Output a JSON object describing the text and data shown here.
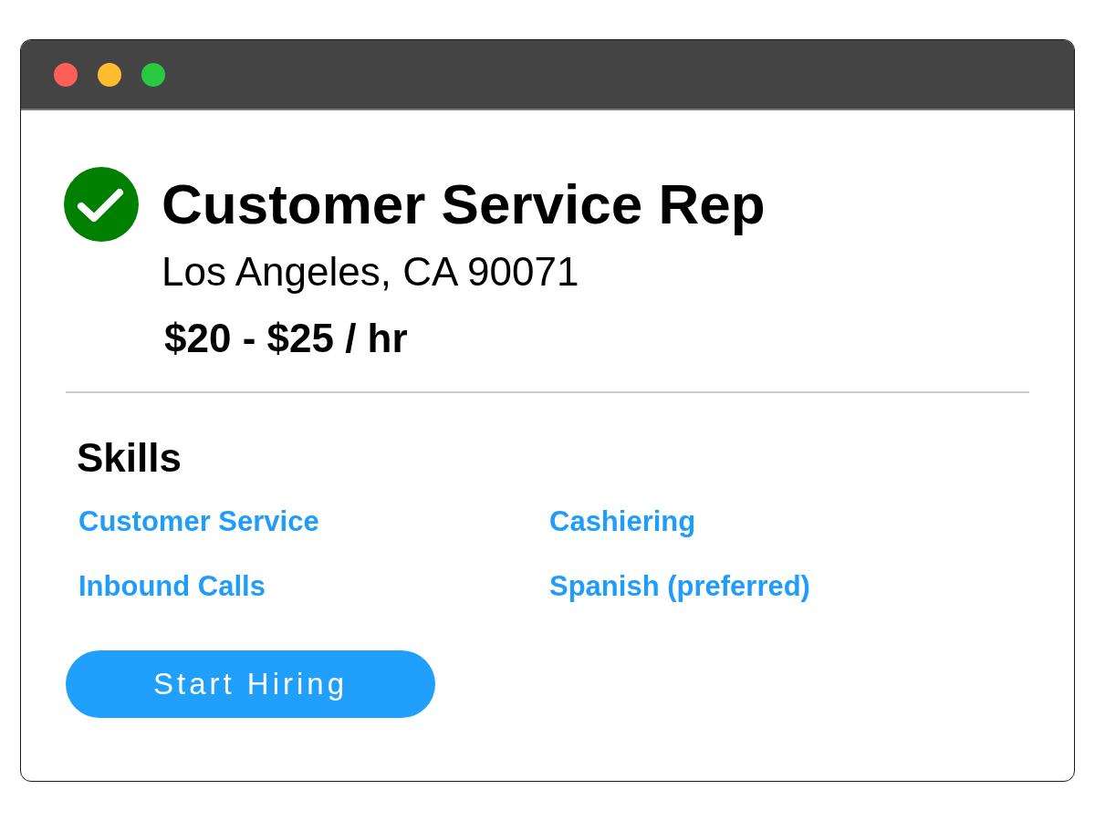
{
  "window": {
    "controls": [
      {
        "color": "#ff5f57"
      },
      {
        "color": "#febc2e"
      },
      {
        "color": "#28c840"
      }
    ]
  },
  "job": {
    "title": "Customer Service Rep",
    "location": "Los Angeles, CA 90071",
    "salary": "$20 - $25 / hr"
  },
  "skills": {
    "heading": "Skills",
    "items": [
      "Customer Service",
      "Cashiering",
      "Inbound Calls",
      "Spanish (preferred)"
    ]
  },
  "action": {
    "label": "Start Hiring"
  }
}
